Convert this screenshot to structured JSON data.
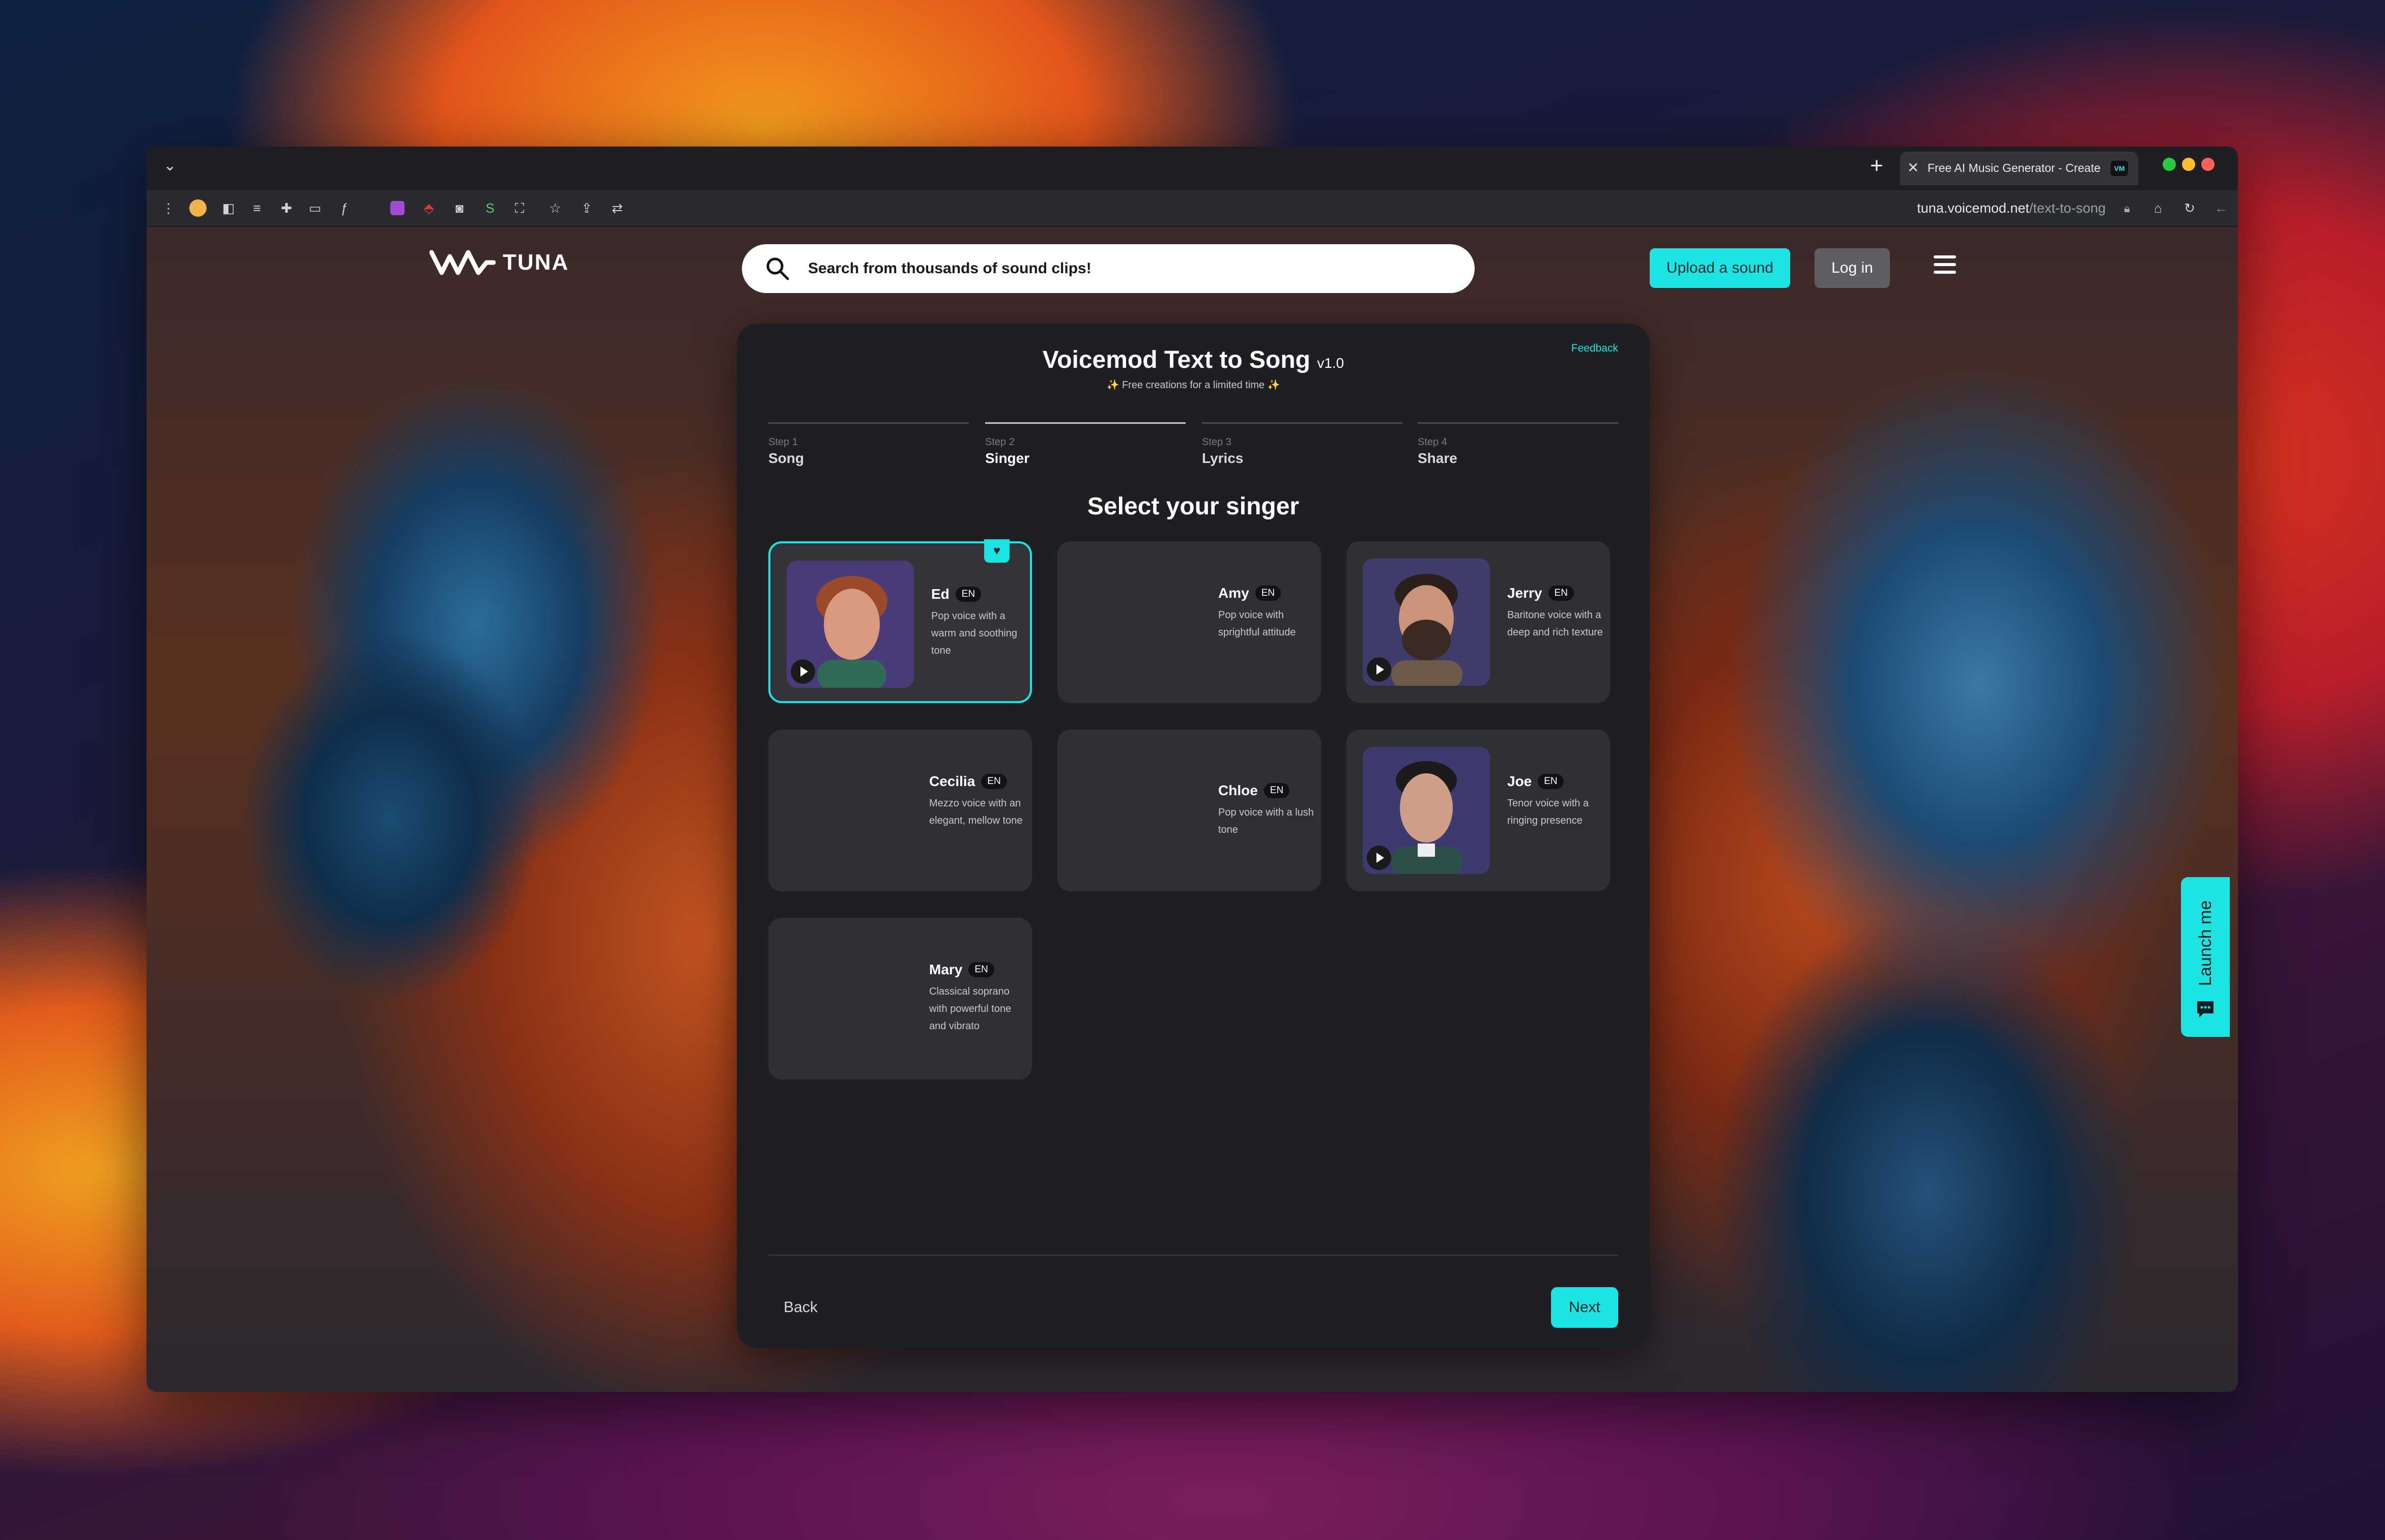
{
  "browser": {
    "tab_title": "Free AI Music Generator - Create",
    "tab_favicon": "VM",
    "url_host": "tuna.voicemod.net",
    "url_path": "/text-to-song",
    "traffic_colors": [
      "#2bc840",
      "#febc2e",
      "#ff5f57"
    ]
  },
  "header": {
    "logo_text": "TUNA",
    "search_placeholder": "Search from thousands of sound clips!",
    "upload_label": "Upload a sound",
    "login_label": "Log in"
  },
  "modal": {
    "feedback": "Feedback",
    "title": "Voicemod Text to Song",
    "version": "v1.0",
    "subtitle": "✨ Free creations for a limited time ✨",
    "steps": [
      {
        "num": "Step 1",
        "name": "Song"
      },
      {
        "num": "Step 2",
        "name": "Singer"
      },
      {
        "num": "Step 3",
        "name": "Lyrics"
      },
      {
        "num": "Step 4",
        "name": "Share"
      }
    ],
    "active_step": 2,
    "select_title": "Select your singer",
    "singers": [
      {
        "name": "Ed",
        "lang": "EN",
        "desc": "Pop voice with a warm and soothing tone",
        "selected": true
      },
      {
        "name": "Amy",
        "lang": "EN",
        "desc": "Pop voice with sprightful attitude"
      },
      {
        "name": "Jerry",
        "lang": "EN",
        "desc": "Baritone voice with a deep and rich texture"
      },
      {
        "name": "Cecilia",
        "lang": "EN",
        "desc": "Mezzo voice with an elegant, mellow tone"
      },
      {
        "name": "Chloe",
        "lang": "EN",
        "desc": "Pop voice with a lush tone"
      },
      {
        "name": "Joe",
        "lang": "EN",
        "desc": "Tenor voice with a ringing presence"
      },
      {
        "name": "Mary",
        "lang": "EN",
        "desc": "Classical soprano with powerful tone and vibrato"
      }
    ],
    "back_label": "Back",
    "next_label": "Next"
  },
  "launcher": {
    "label": "Launch me"
  },
  "colors": {
    "accent": "#1ee3e3",
    "modal_bg": "#1e1f22",
    "card_bg": "#2f3034"
  }
}
